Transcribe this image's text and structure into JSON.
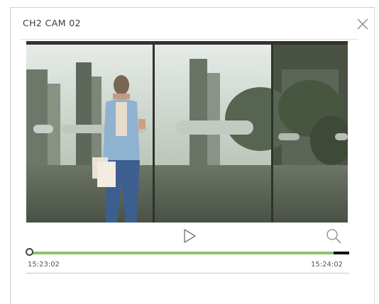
{
  "dialog": {
    "title": "CH2 CAM 02"
  },
  "icons": {
    "close": "close-icon",
    "play": "play-icon",
    "zoom": "magnifier-icon"
  },
  "playback": {
    "start_time": "15:23:02",
    "end_time": "15:24:02",
    "progress": 0.0,
    "buffered_fraction": 0.95
  },
  "colors": {
    "timeline_played": "#8fc26a",
    "timeline_remaining": "#111111"
  }
}
